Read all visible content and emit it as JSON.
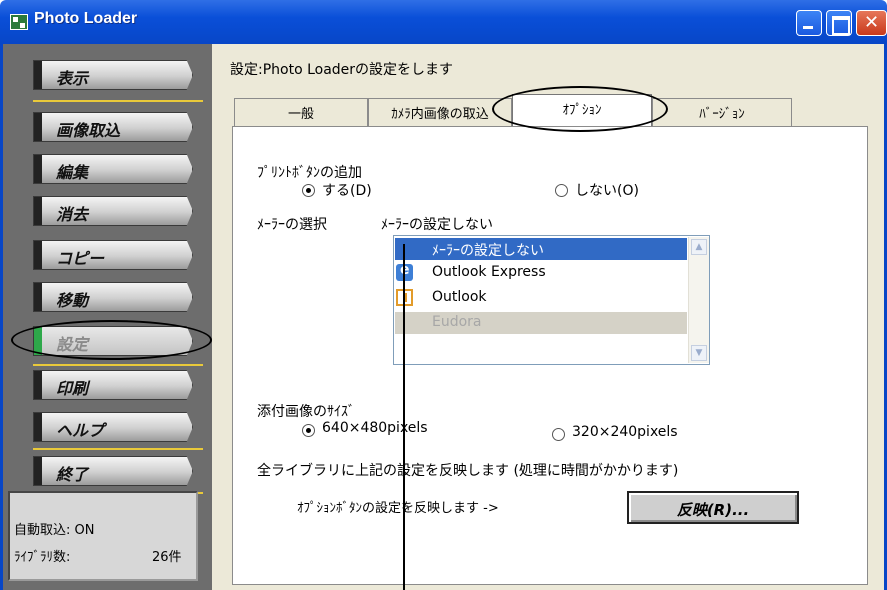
{
  "window": {
    "title": "Photo Loader"
  },
  "sidebar": {
    "items": [
      {
        "label": "表示"
      },
      {
        "label": "画像取込"
      },
      {
        "label": "編集"
      },
      {
        "label": "消去"
      },
      {
        "label": "コピー"
      },
      {
        "label": "移動"
      },
      {
        "label": "設定",
        "active": true
      },
      {
        "label": "印刷"
      },
      {
        "label": "ヘルプ"
      },
      {
        "label": "終了"
      }
    ],
    "status": {
      "auto_import": "自動取込: ON",
      "library_count_label": "ﾗｲﾌﾞﾗﾘ数:",
      "library_count_value": "26件"
    }
  },
  "main": {
    "description": "設定:Photo Loaderの設定をします",
    "tabs": [
      {
        "label": "一般"
      },
      {
        "label": "ｶﾒﾗ内画像の取込"
      },
      {
        "label": "ｵﾌﾟｼｮﾝ",
        "active": true
      },
      {
        "label": "ﾊﾞｰｼﾞｮﾝ"
      }
    ],
    "print_button_label": "ﾌﾟﾘﾝﾄﾎﾞﾀﾝの追加",
    "print_yes": "する(D)",
    "print_no": "しない(O)",
    "mailer_label": "ﾒｰﾗｰの選択",
    "mailer_current": "ﾒｰﾗｰの設定しない",
    "mailer_options": [
      "ﾒｰﾗｰの設定しない",
      "Outlook Express",
      "Outlook",
      "Eudora"
    ],
    "attach_size_label": "添付画像のｻｲｽﾞ",
    "size_640": "640×480pixels",
    "size_320": "320×240pixels",
    "apply_all_text": "全ライブラリに上記の設定を反映します (処理に時間がかかります)",
    "apply_option_text": "ｵﾌﾟｼｮﾝﾎﾞﾀﾝの設定を反映します ->",
    "apply_button": "反映(R)..."
  }
}
